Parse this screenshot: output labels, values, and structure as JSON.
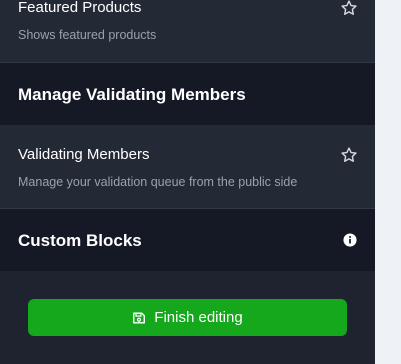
{
  "featured": {
    "title": "Featured Products",
    "description": "Shows featured products"
  },
  "validating_section": {
    "heading": "Manage Validating Members"
  },
  "validating_item": {
    "title": "Validating Members",
    "description": "Manage your validation queue from the public side"
  },
  "custom_section": {
    "heading": "Custom Blocks"
  },
  "actions": {
    "finish_label": "Finish editing"
  },
  "colors": {
    "accent": "#16a81c",
    "panel": "#1f2330",
    "item_bg": "#242936",
    "section_bg": "#141925",
    "page_bg": "#eef1f6"
  },
  "icons": {
    "favorite": "star-outline-icon",
    "info": "info-circle-icon",
    "save": "floppy-disk-icon"
  }
}
